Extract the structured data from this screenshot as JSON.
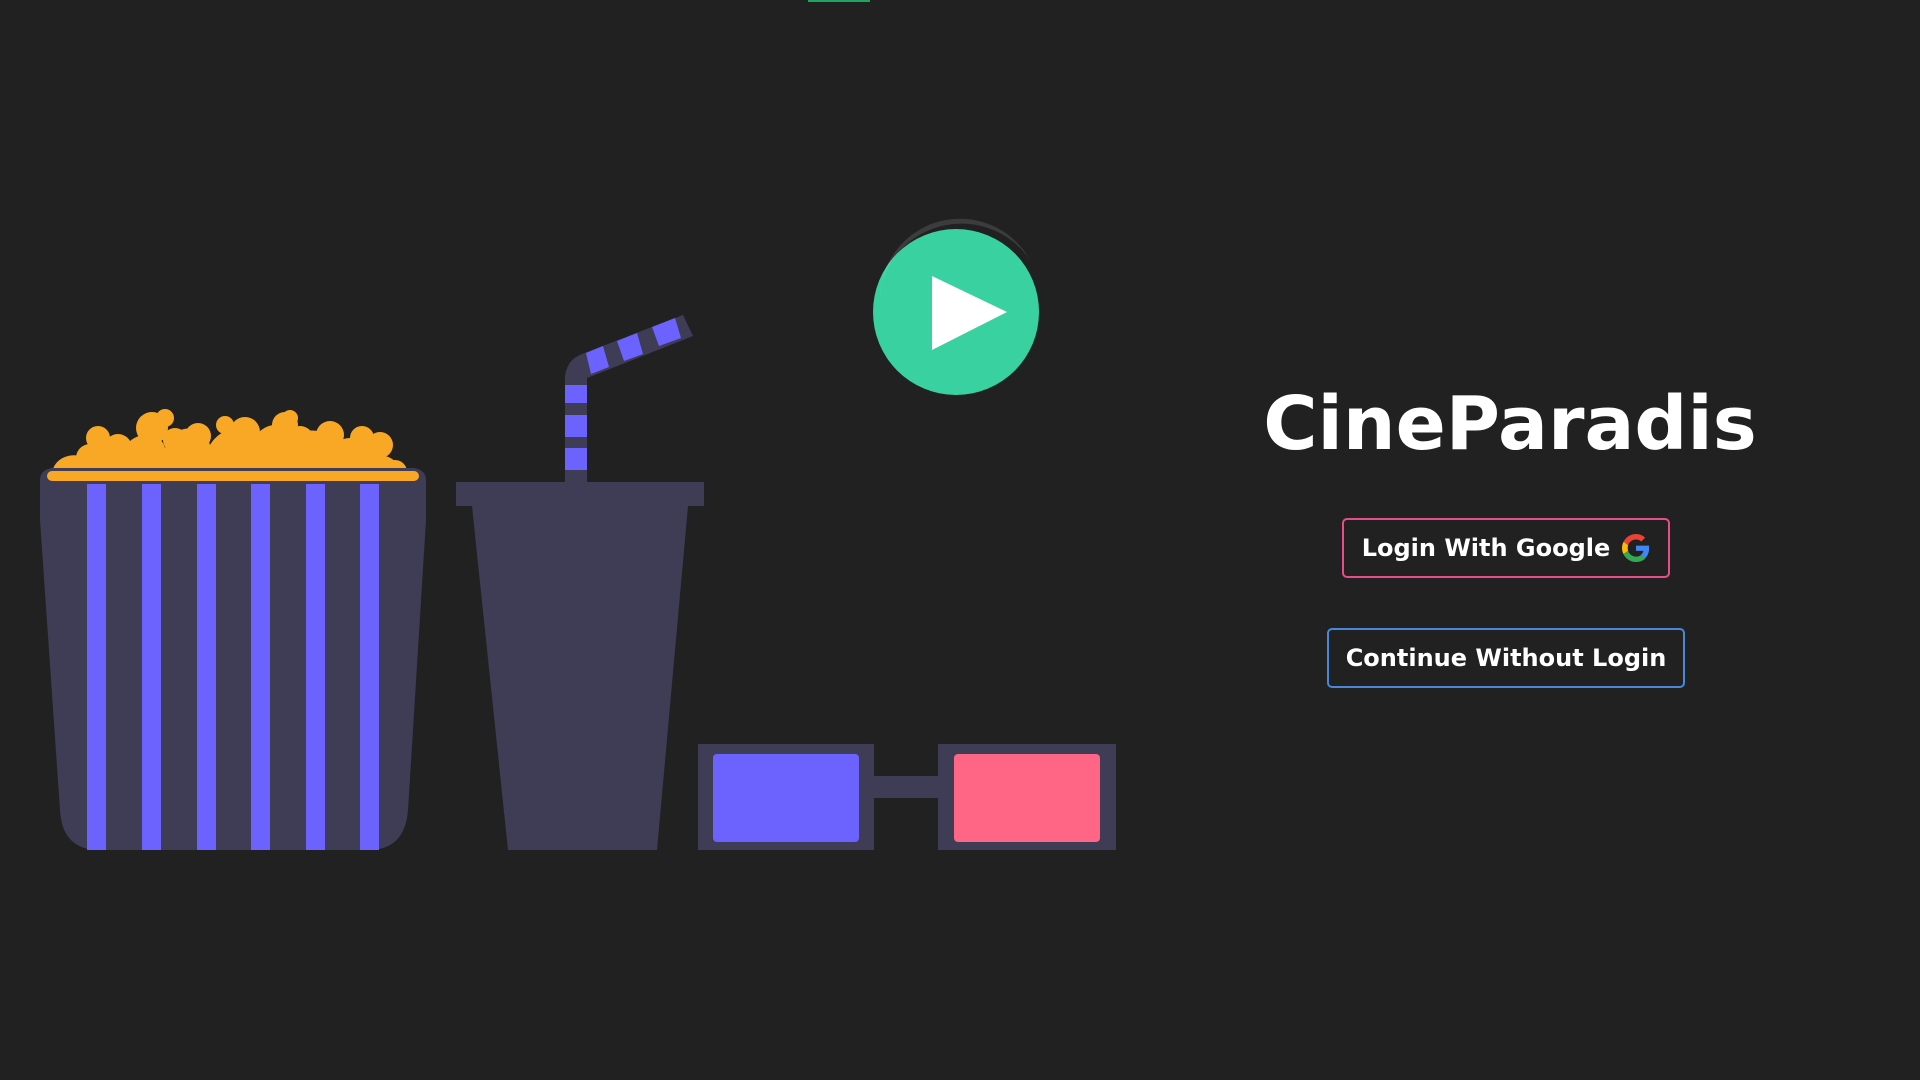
{
  "app": {
    "title": "CineParadis"
  },
  "actions": {
    "google_login_label": "Login With Google",
    "continue_label": "Continue Without Login"
  },
  "icons": {
    "play": "play-icon",
    "google": "google-g-icon"
  },
  "colors": {
    "background": "#212121",
    "play_button": "#3ad1a0",
    "google_border": "#e84d8a",
    "guest_border": "#4a86d9",
    "popcorn": "#f9a826",
    "stripes": "#6c63ff",
    "container": "#3f3d56",
    "lens_left": "#6c63ff",
    "lens_right": "#ff6584"
  }
}
